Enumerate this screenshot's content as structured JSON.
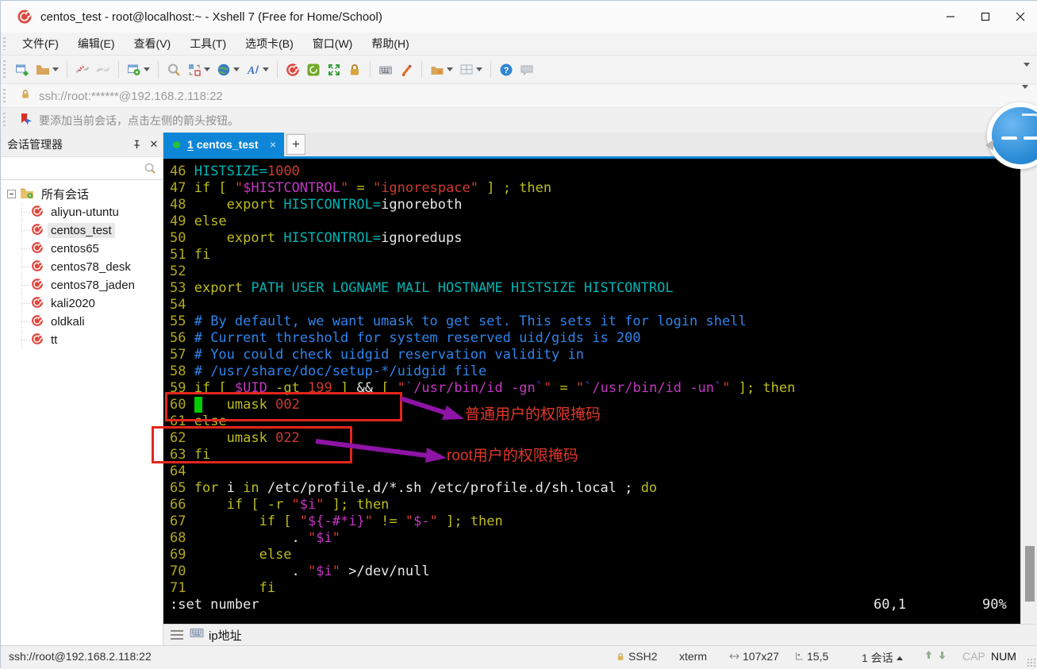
{
  "window": {
    "title": "centos_test - root@localhost:~ - Xshell 7 (Free for Home/School)",
    "controls": {
      "minimize": "─",
      "maximize": "□",
      "close": "✕"
    }
  },
  "menu": {
    "items": [
      "文件(F)",
      "编辑(E)",
      "查看(V)",
      "工具(T)",
      "选项卡(B)",
      "窗口(W)",
      "帮助(H)"
    ]
  },
  "toolbar": {
    "items": [
      {
        "name": "new-session-icon"
      },
      {
        "name": "open-folder-icon",
        "caret": true
      },
      {
        "sep": true
      },
      {
        "name": "disconnect-icon"
      },
      {
        "name": "reconnect-icon"
      },
      {
        "sep": true
      },
      {
        "name": "properties-icon",
        "caret": true
      },
      {
        "sep": true
      },
      {
        "name": "find-icon"
      },
      {
        "name": "layout-icon",
        "caret": true
      },
      {
        "name": "encoding-globe-icon",
        "caret": true
      },
      {
        "name": "font-icon",
        "caret": true
      },
      {
        "sep": true
      },
      {
        "name": "xshell-icon"
      },
      {
        "name": "xftp-icon"
      },
      {
        "name": "fullscreen-icon"
      },
      {
        "name": "lock-icon"
      },
      {
        "sep": true
      },
      {
        "name": "keyboard-icon"
      },
      {
        "name": "highlighter-icon"
      },
      {
        "sep": true
      },
      {
        "name": "new-folder-icon",
        "caret": true
      },
      {
        "name": "tile-windows-icon",
        "caret": true
      },
      {
        "sep": true
      },
      {
        "name": "help-icon"
      },
      {
        "name": "feedback-icon"
      }
    ]
  },
  "address_bar": {
    "url": "ssh://root:******@192.168.2.118:22"
  },
  "info_bar": {
    "text": "要添加当前会话，点击左侧的箭头按钮。"
  },
  "session_manager": {
    "title": "会话管理器",
    "search_placeholder": "",
    "root_label": "所有会话",
    "sessions": [
      {
        "label": "aliyun-utuntu",
        "selected": false
      },
      {
        "label": "centos_test",
        "selected": true
      },
      {
        "label": "centos65",
        "selected": false
      },
      {
        "label": "centos78_desk",
        "selected": false
      },
      {
        "label": "centos78_jaden",
        "selected": false
      },
      {
        "label": "kali2020",
        "selected": false
      },
      {
        "label": "oldkali",
        "selected": false
      },
      {
        "label": "tt",
        "selected": false
      }
    ]
  },
  "tabs": {
    "active_index": "1",
    "active_label": "centos_test",
    "close": "×",
    "new_tab": "+"
  },
  "terminal": {
    "lines": [
      {
        "num": "46",
        "segs": [
          [
            "c",
            "HISTSIZE="
          ],
          [
            "r",
            "1000"
          ]
        ]
      },
      {
        "num": "47",
        "segs": [
          [
            "y",
            "if [ "
          ],
          [
            "r",
            "\""
          ],
          [
            "m",
            "$HISTCONTROL"
          ],
          [
            "r",
            "\""
          ],
          [
            "y",
            " = "
          ],
          [
            "r",
            "\"ignorespace\""
          ],
          [
            "y",
            " ] ; then"
          ]
        ]
      },
      {
        "num": "48",
        "segs": [
          [
            "y",
            "    export "
          ],
          [
            "c",
            "HISTCONTROL="
          ],
          [
            "w",
            "ignoreboth"
          ]
        ]
      },
      {
        "num": "49",
        "segs": [
          [
            "y",
            "else"
          ]
        ]
      },
      {
        "num": "50",
        "segs": [
          [
            "y",
            "    export "
          ],
          [
            "c",
            "HISTCONTROL="
          ],
          [
            "w",
            "ignoredups"
          ]
        ]
      },
      {
        "num": "51",
        "segs": [
          [
            "y",
            "fi"
          ]
        ]
      },
      {
        "num": "52",
        "segs": []
      },
      {
        "num": "53",
        "segs": [
          [
            "y",
            "export "
          ],
          [
            "c",
            "PATH USER LOGNAME MAIL HOSTNAME HISTSIZE HISTCONTROL"
          ]
        ]
      },
      {
        "num": "54",
        "segs": []
      },
      {
        "num": "55",
        "segs": [
          [
            "b",
            "# By default, we want umask to get set. This sets it for login shell"
          ]
        ]
      },
      {
        "num": "56",
        "segs": [
          [
            "b",
            "# Current threshold for system reserved uid/gids is 200"
          ]
        ]
      },
      {
        "num": "57",
        "segs": [
          [
            "b",
            "# You could check uidgid reservation validity in"
          ]
        ]
      },
      {
        "num": "58",
        "segs": [
          [
            "b",
            "# /usr/share/doc/setup-*/uidgid file"
          ]
        ]
      },
      {
        "num": "59",
        "segs": [
          [
            "y",
            "if [ "
          ],
          [
            "m",
            "$UID"
          ],
          [
            "y",
            " -gt "
          ],
          [
            "r",
            "199"
          ],
          [
            "y",
            " ] "
          ],
          [
            "w",
            "&& "
          ],
          [
            "y",
            "[ "
          ],
          [
            "r",
            "\""
          ],
          [
            "k",
            "`"
          ],
          [
            "m",
            "/usr/bin/id -gn"
          ],
          [
            "k",
            "`"
          ],
          [
            "r",
            "\""
          ],
          [
            "y",
            " = "
          ],
          [
            "r",
            "\""
          ],
          [
            "k",
            "`"
          ],
          [
            "m",
            "/usr/bin/id -un"
          ],
          [
            "k",
            "`"
          ],
          [
            "r",
            "\""
          ],
          [
            "y",
            " ]; then"
          ]
        ]
      },
      {
        "num": "60",
        "segs": [
          [
            "cur",
            " "
          ],
          [
            "y",
            "   umask "
          ],
          [
            "r",
            "002"
          ]
        ]
      },
      {
        "num": "61",
        "segs": [
          [
            "y",
            "else"
          ]
        ]
      },
      {
        "num": "62",
        "segs": [
          [
            "y",
            "    umask "
          ],
          [
            "r",
            "022"
          ]
        ]
      },
      {
        "num": "63",
        "segs": [
          [
            "y",
            "fi"
          ]
        ]
      },
      {
        "num": "64",
        "segs": []
      },
      {
        "num": "65",
        "segs": [
          [
            "y",
            "for "
          ],
          [
            "w",
            "i "
          ],
          [
            "y",
            "in "
          ],
          [
            "w",
            "/etc/profile.d/*.sh /etc/profile.d/sh.local ; "
          ],
          [
            "y",
            "do"
          ]
        ]
      },
      {
        "num": "66",
        "segs": [
          [
            "y",
            "    if [ -r "
          ],
          [
            "r",
            "\""
          ],
          [
            "m",
            "$i"
          ],
          [
            "r",
            "\""
          ],
          [
            "y",
            " ]; then"
          ]
        ]
      },
      {
        "num": "67",
        "segs": [
          [
            "y",
            "        if [ "
          ],
          [
            "r",
            "\""
          ],
          [
            "m",
            "${-#*i}"
          ],
          [
            "r",
            "\""
          ],
          [
            "y",
            " != "
          ],
          [
            "r",
            "\""
          ],
          [
            "m",
            "$-"
          ],
          [
            "r",
            "\""
          ],
          [
            "y",
            " ]; then"
          ]
        ]
      },
      {
        "num": "68",
        "segs": [
          [
            "w",
            "            . "
          ],
          [
            "r",
            "\""
          ],
          [
            "m",
            "$i"
          ],
          [
            "r",
            "\""
          ]
        ]
      },
      {
        "num": "69",
        "segs": [
          [
            "y",
            "        else"
          ]
        ]
      },
      {
        "num": "70",
        "segs": [
          [
            "w",
            "            . "
          ],
          [
            "r",
            "\""
          ],
          [
            "m",
            "$i"
          ],
          [
            "r",
            "\""
          ],
          [
            "w",
            " >/dev/null"
          ]
        ]
      },
      {
        "num": "71",
        "segs": [
          [
            "y",
            "        fi"
          ]
        ]
      }
    ],
    "status_line": {
      "command": ":set number",
      "position": "60,1",
      "percent": "90%"
    }
  },
  "annotations": {
    "box1_label": "普通用户的权限掩码",
    "box2_label": "root用户的权限掩码",
    "box_color": "#e3261d",
    "arrow_color": "#8d14a4",
    "label_color": "#e0372b"
  },
  "quick_bar": {
    "label": "ip地址"
  },
  "status_bar": {
    "left": "ssh://root@192.168.2.118:22",
    "protocol": "SSH2",
    "term_type": "xterm",
    "size": "107x27",
    "position": "15,5",
    "session_count": "1 会话",
    "cap": "CAP",
    "num": "NUM"
  },
  "colors": {
    "tab_active": "#0e86d8",
    "terminal_bg": "#000000",
    "cursor": "#00cc00",
    "keyword_yellow": "#bdbd1e",
    "var_cyan": "#00b4b4",
    "string_red": "#cd3a30",
    "magenta": "#c238c2",
    "comment_blue": "#2e85ec"
  }
}
